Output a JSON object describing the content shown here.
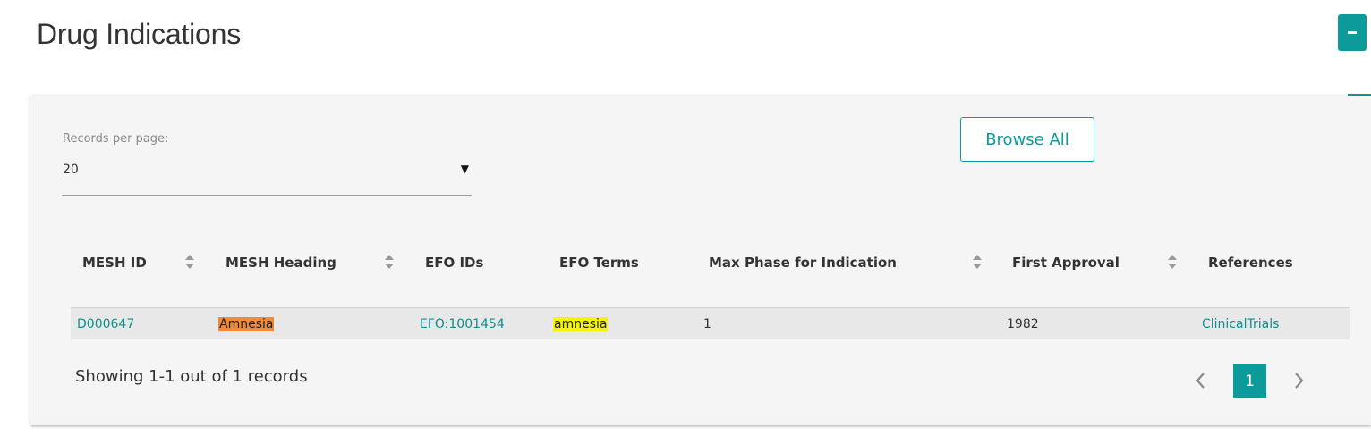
{
  "section": {
    "title": "Drug Indications"
  },
  "controls": {
    "records_per_page_label": "Records per page:",
    "records_per_page_value": "20",
    "browse_all_label": "Browse All"
  },
  "table": {
    "columns": [
      "MESH ID",
      "MESH Heading",
      "EFO IDs",
      "EFO Terms",
      "Max Phase for Indication",
      "First Approval",
      "References"
    ],
    "rows": [
      {
        "mesh_id": "D000647",
        "mesh_heading": "Amnesia",
        "efo_ids": "EFO:1001454",
        "efo_terms": "amnesia",
        "max_phase": "1",
        "first_approval": "1982",
        "references": "ClinicalTrials"
      }
    ]
  },
  "footer": {
    "showing_text": "Showing 1-1 out of 1 records",
    "current_page": "1"
  },
  "colors": {
    "accent": "#0d9a9a",
    "highlight_heading": "#f28a37",
    "highlight_term": "#f5f500"
  }
}
